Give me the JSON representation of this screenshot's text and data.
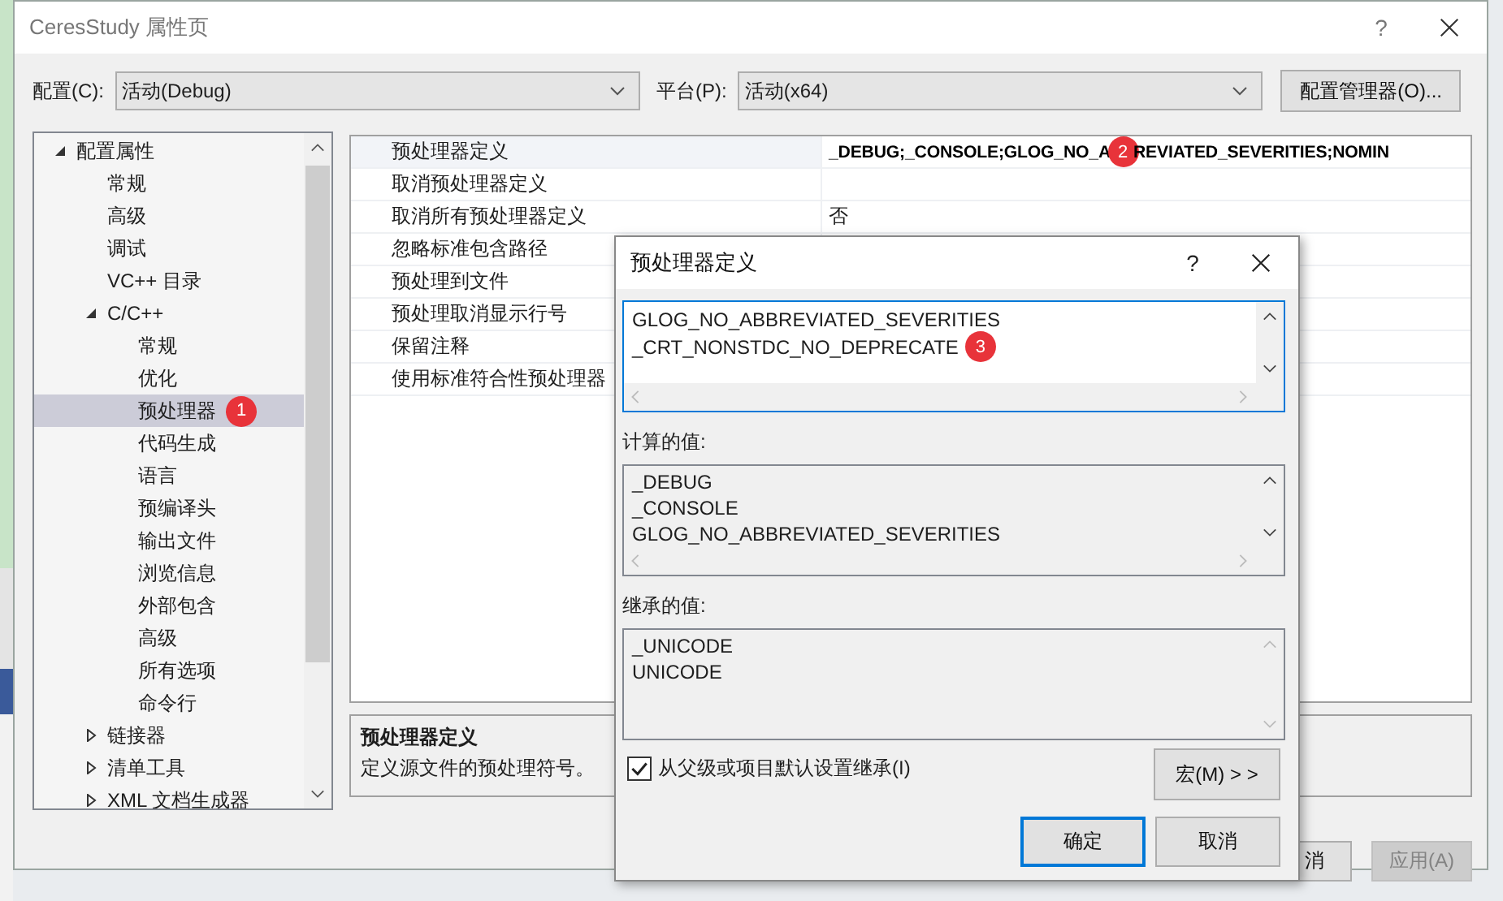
{
  "window": {
    "title": "CeresStudy 属性页",
    "help": "?"
  },
  "config": {
    "label": "配置(C):",
    "value": "活动(Debug)"
  },
  "platform": {
    "label": "平台(P):",
    "value": "活动(x64)"
  },
  "config_manager_button": "配置管理器(O)...",
  "tree": [
    {
      "label": "配置属性",
      "expanded": true,
      "selected": false,
      "children": [
        {
          "label": "常规",
          "selected": false
        },
        {
          "label": "高级",
          "selected": false
        },
        {
          "label": "调试",
          "selected": false
        },
        {
          "label": "VC++ 目录",
          "selected": false
        },
        {
          "label": "C/C++",
          "expanded": true,
          "selected": false,
          "children": [
            {
              "label": "常规",
              "selected": false
            },
            {
              "label": "优化",
              "selected": false
            },
            {
              "label": "预处理器",
              "selected": true,
              "marker": "1"
            },
            {
              "label": "代码生成",
              "selected": false
            },
            {
              "label": "语言",
              "selected": false
            },
            {
              "label": "预编译头",
              "selected": false
            },
            {
              "label": "输出文件",
              "selected": false
            },
            {
              "label": "浏览信息",
              "selected": false
            },
            {
              "label": "外部包含",
              "selected": false
            },
            {
              "label": "高级",
              "selected": false
            },
            {
              "label": "所有选项",
              "selected": false
            },
            {
              "label": "命令行",
              "selected": false
            }
          ]
        },
        {
          "label": "链接器",
          "expanded": false,
          "selected": false
        },
        {
          "label": "清单工具",
          "expanded": false,
          "selected": false
        },
        {
          "label": "XML 文档生成器",
          "expanded": false,
          "selected": false
        }
      ]
    }
  ],
  "properties": [
    {
      "name": "预处理器定义",
      "selected": true,
      "modified": true,
      "value": "_DEBUG;_CONSOLE;GLOG_NO_A",
      "marker": "2",
      "value_after": "REVIATED_SEVERITIES;NOMIN"
    },
    {
      "name": "取消预处理器定义",
      "selected": false
    },
    {
      "name": "取消所有预处理器定义",
      "selected": false,
      "modified": false,
      "value": "否"
    },
    {
      "name": "忽略标准包含路径",
      "selected": false
    },
    {
      "name": "预处理到文件",
      "selected": false
    },
    {
      "name": "预处理取消显示行号",
      "selected": false
    },
    {
      "name": "保留注释",
      "selected": false
    },
    {
      "name": "使用标准符合性预处理器",
      "selected": false
    }
  ],
  "description": {
    "title": "预处理器定义",
    "text": "定义源文件的预处理符号。"
  },
  "buttons": [
    {
      "label": "消",
      "disabled": false
    },
    {
      "label": "应用(A)",
      "disabled": true
    }
  ],
  "dialog": {
    "title": "预处理器定义",
    "help": "?",
    "definitions": {
      "lines": [
        "GLOG_NO_ABBREVIATED_SEVERITIES",
        "_CRT_NONSTDC_NO_DEPRECATE"
      ],
      "marker": "3"
    },
    "computed": {
      "label": "计算的值:",
      "lines": [
        "_DEBUG",
        "_CONSOLE",
        "GLOG_NO_ABBREVIATED_SEVERITIES"
      ]
    },
    "inherited": {
      "label": "继承的值:",
      "lines": [
        "_UNICODE",
        "UNICODE"
      ]
    },
    "inherit_checkbox": {
      "label": "从父级或项目默认设置继承(I)",
      "checked": true
    },
    "macro_button": "宏(M) > >",
    "ok_button": "确定",
    "cancel_button": "取消"
  }
}
